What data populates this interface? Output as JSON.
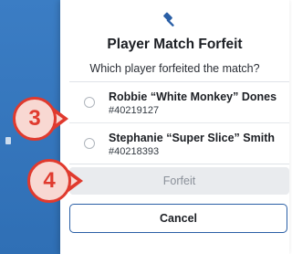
{
  "modal": {
    "icon": "gavel-icon",
    "title": "Player Match Forfeit",
    "subtitle": "Which player forfeited the match?",
    "players": [
      {
        "name": "Robbie “White Monkey” Dones",
        "id": "#40219127",
        "selected": false
      },
      {
        "name": "Stephanie “Super Slice” Smith",
        "id": "#40218393",
        "selected": false
      }
    ],
    "forfeit_label": "Forfeit",
    "cancel_label": "Cancel"
  },
  "callouts": {
    "step_a": "3",
    "step_b": "4"
  },
  "colors": {
    "accent": "#2a5fa6",
    "callout": "#e03a2e",
    "callout_fill": "#f8d8d2",
    "background_panel": "#3b7dc4"
  }
}
